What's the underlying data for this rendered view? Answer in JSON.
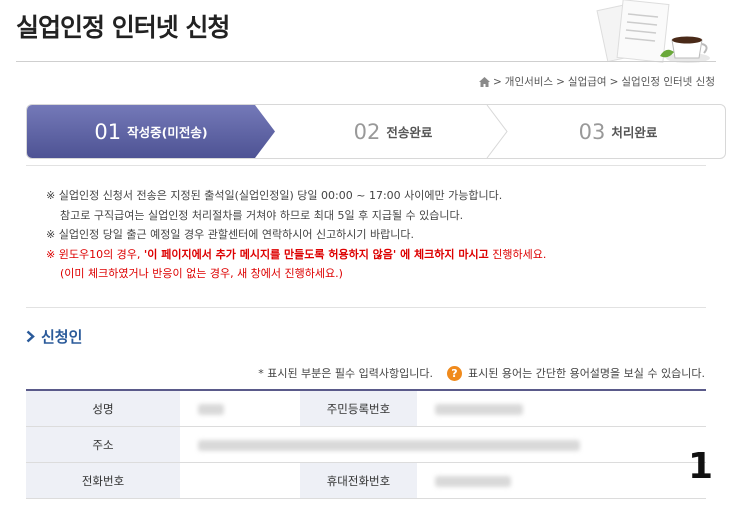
{
  "page": {
    "title": "실업인정 인터넷 신청"
  },
  "breadcrumb": {
    "items": [
      "개인서비스",
      "실업급여",
      "실업인정 인터넷 신청"
    ],
    "separator": ">"
  },
  "steps": [
    {
      "num": "01",
      "label": "작성중(미전송)",
      "active": true
    },
    {
      "num": "02",
      "label": "전송완료",
      "active": false
    },
    {
      "num": "03",
      "label": "처리완료",
      "active": false
    }
  ],
  "notices": {
    "line1": "※ 실업인정 신청서 전송은 지정된 출석일(실업인정일) 당일 00:00 ~ 17:00 사이에만 가능합니다.",
    "line2": "참고로 구직급여는 실업인정 처리절차를 거쳐야 하므로 최대 5일 후 지급될 수 있습니다.",
    "line3": "※ 실업인정 당일 출근 예정일 경우 관할센터에 연락하시어 신고하시기 바랍니다.",
    "line4_prefix": "※ 윈도우10의 경우, ",
    "line4_bold": "'이 페이지에서 추가 메시지를 만들도록 허용하지 않음' 에 체크하지 마시고",
    "line4_suffix": " 진행하세요.",
    "line5": "(이미 체크하였거나 반응이 없는 경우, 새 창에서 진행하세요.)"
  },
  "section": {
    "title": "신청인"
  },
  "hints": {
    "required": "* 표시된 부분은 필수 입력사항입니다.",
    "help_icon": "?",
    "help_text": "표시된 용어는 간단한 용어설명을 보실 수 있습니다."
  },
  "form": {
    "name_label": "성명",
    "rrn_label": "주민등록번호",
    "address_label": "주소",
    "phone_label": "전화번호",
    "mobile_label": "휴대전화번호"
  },
  "overlay_number": "1",
  "colors": {
    "step_active": "#5a5f9e",
    "notice_red": "#dd0000",
    "section_title": "#2a5a9a",
    "help_icon": "#f08a1c"
  },
  "icons": {
    "home": "home-icon",
    "section": "chevron-right-icon",
    "help": "question-icon"
  }
}
